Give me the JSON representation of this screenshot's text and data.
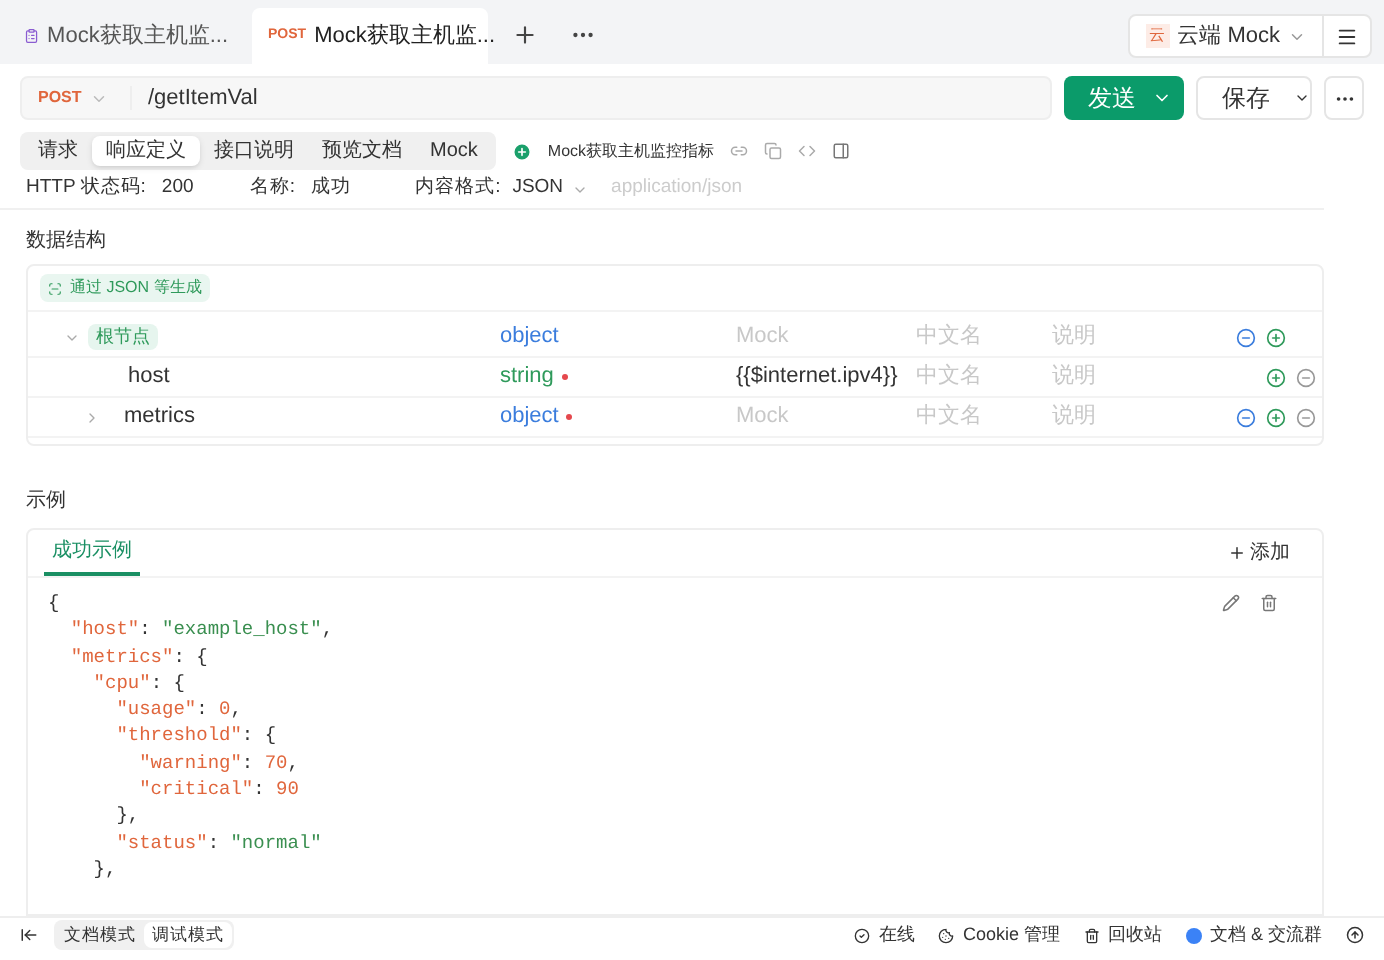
{
  "tabs": [
    {
      "title": "Mock获取主机监...",
      "selected": false
    },
    {
      "method": "POST",
      "title": "Mock获取主机监...",
      "selected": true
    }
  ],
  "env": {
    "label": "云端 Mock",
    "badge": "云"
  },
  "request": {
    "method": "POST",
    "url": "/getItemVal",
    "send": "发送",
    "save": "保存"
  },
  "subtabs": [
    {
      "label": "请求",
      "selected": false
    },
    {
      "label": "响应定义",
      "selected": true
    },
    {
      "label": "接口说明",
      "selected": false
    },
    {
      "label": "预览文档",
      "selected": false
    },
    {
      "label": "Mock",
      "selected": false
    }
  ],
  "response_name": "Mock获取主机监控指标",
  "meta": {
    "status_label": "HTTP 状态码:",
    "status": "200",
    "name_label": "名称:",
    "name": "成功",
    "format_label": "内容格式:",
    "format": "JSON",
    "content_type": "application/json"
  },
  "schema": {
    "title": "数据结构",
    "generate": "通过 JSON 等生成",
    "rows": [
      {
        "name": "根节点",
        "kind": "root",
        "type": "object",
        "required": false,
        "mock": "Mock",
        "mock_filled": false,
        "cn": "中文名",
        "desc": "说明",
        "expanded": true
      },
      {
        "name": "host",
        "kind": "leaf",
        "type": "string",
        "required": true,
        "mock": "{{$internet.ipv4}}",
        "mock_filled": true,
        "cn": "中文名",
        "desc": "说明"
      },
      {
        "name": "metrics",
        "kind": "branch",
        "type": "object",
        "required": true,
        "mock": "Mock",
        "mock_filled": false,
        "cn": "中文名",
        "desc": "说明",
        "expanded": false
      }
    ]
  },
  "examples": {
    "title": "示例",
    "tabs": [
      {
        "label": "成功示例",
        "selected": true
      }
    ],
    "add": "添加",
    "code": [
      [
        {
          "kind": "punct",
          "text": "{"
        }
      ],
      [
        {
          "kind": "key",
          "text": "  \"host\""
        },
        {
          "kind": "punct",
          "text": ": "
        },
        {
          "kind": "str",
          "text": "\"example_host\""
        },
        {
          "kind": "punct",
          "text": ","
        }
      ],
      [
        {
          "kind": "key",
          "text": "  \"metrics\""
        },
        {
          "kind": "punct",
          "text": ": {"
        }
      ],
      [
        {
          "kind": "key",
          "text": "    \"cpu\""
        },
        {
          "kind": "punct",
          "text": ": {"
        }
      ],
      [
        {
          "kind": "key",
          "text": "      \"usage\""
        },
        {
          "kind": "punct",
          "text": ": "
        },
        {
          "kind": "num",
          "text": "0"
        },
        {
          "kind": "punct",
          "text": ","
        }
      ],
      [
        {
          "kind": "key",
          "text": "      \"threshold\""
        },
        {
          "kind": "punct",
          "text": ": {"
        }
      ],
      [
        {
          "kind": "key",
          "text": "        \"warning\""
        },
        {
          "kind": "punct",
          "text": ": "
        },
        {
          "kind": "num",
          "text": "70"
        },
        {
          "kind": "punct",
          "text": ","
        }
      ],
      [
        {
          "kind": "key",
          "text": "        \"critical\""
        },
        {
          "kind": "punct",
          "text": ": "
        },
        {
          "kind": "num",
          "text": "90"
        }
      ],
      [
        {
          "kind": "punct",
          "text": "      },"
        }
      ],
      [
        {
          "kind": "key",
          "text": "      \"status\""
        },
        {
          "kind": "punct",
          "text": ": "
        },
        {
          "kind": "str",
          "text": "\"normal\""
        }
      ],
      [
        {
          "kind": "punct",
          "text": "    },"
        }
      ]
    ]
  },
  "status_bar": {
    "modes": [
      {
        "label": "文档模式",
        "selected": false
      },
      {
        "label": "调试模式",
        "selected": true
      }
    ],
    "online": "在线",
    "cookie": "Cookie 管理",
    "trash": "回收站",
    "docs": "文档 & 交流群"
  }
}
